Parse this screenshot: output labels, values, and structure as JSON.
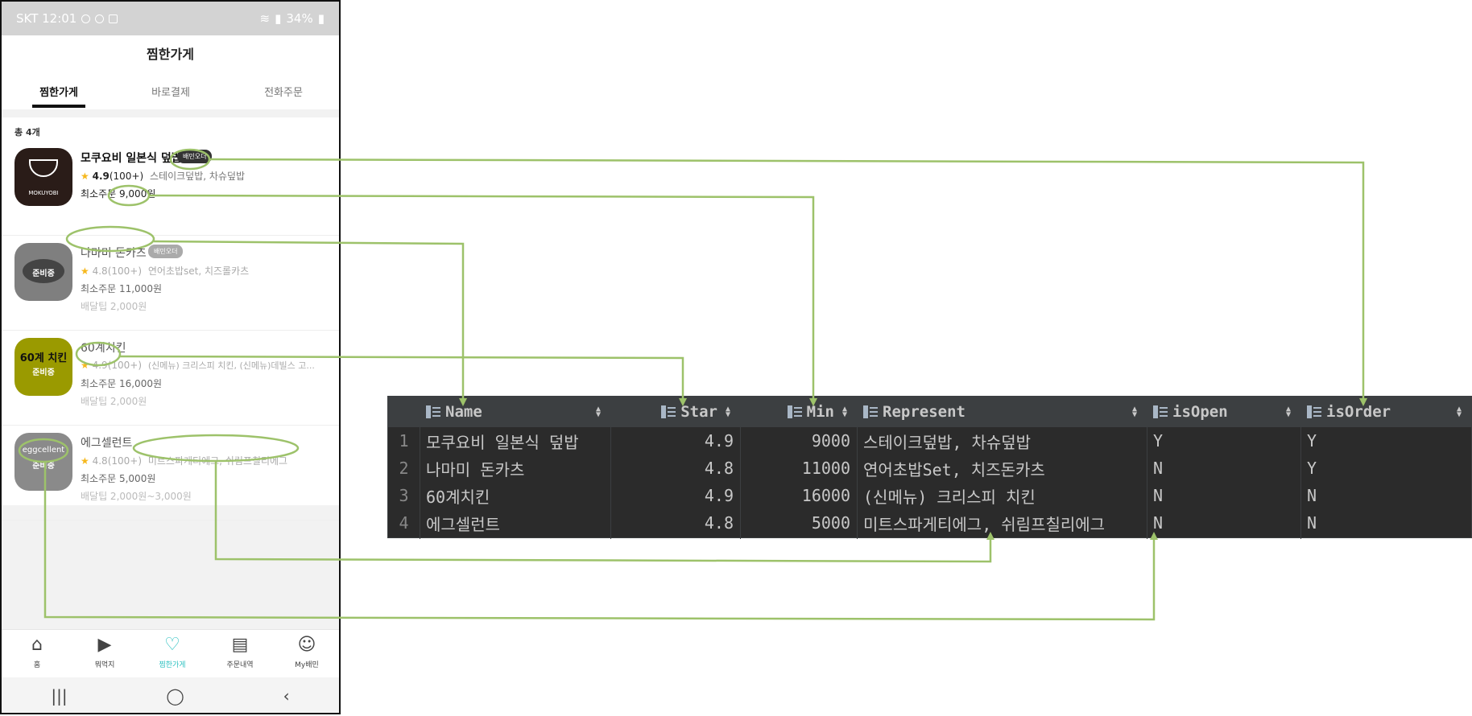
{
  "status": {
    "carrier_time": "SKT 12:01",
    "battery": "34%"
  },
  "header": {
    "title": "찜한가게"
  },
  "tabs": [
    {
      "label": "찜한가게"
    },
    {
      "label": "바로결제"
    },
    {
      "label": "전화주문"
    }
  ],
  "list": {
    "total": "총 4개"
  },
  "stores": [
    {
      "name": "모쿠요비 일본식 덮밥",
      "badge": "배민오더",
      "star": "★",
      "rating": "4.9",
      "reviews": "(100+)",
      "menu": "스테이크덮밥, 차슈덮밥",
      "min_order": "최소주문 9,000원",
      "logo_text": "MOKUYOBI",
      "logo_icon": "rice-bowl-icon"
    },
    {
      "name": "나마미 돈카츠",
      "badge": "배민오더",
      "star": "★",
      "rating": "4.8",
      "reviews": "(100+)",
      "menu": "연어초밥set, 치즈롤카츠",
      "min_order": "최소주문 11,000원",
      "tip": "배달팁 2,000원",
      "logo_text": "준비중"
    },
    {
      "name": "60계치킨",
      "star": "★",
      "rating": "4.9",
      "reviews": "(100+)",
      "menu": "(신메뉴) 크리스피 치킨, (신메뉴)데빌스 고...",
      "min_order": "최소주문 16,000원",
      "tip": "배달팁 2,000원",
      "logo_title": "60계 치킨",
      "logo_text": "준비중"
    },
    {
      "name": "에그셀런트",
      "star": "★",
      "rating": "4.8",
      "reviews": "(100+)",
      "menu": "미트스파게티에그, 쉬림프칠리에그",
      "min_order": "최소주문 5,000원",
      "tip": "배달팁 2,000원~3,000원",
      "logo_title": "eggcellent",
      "logo_text": "준비중"
    }
  ],
  "bottom_nav": [
    {
      "label": "홈",
      "icon": "home-icon"
    },
    {
      "label": "뭐먹지",
      "icon": "play-icon"
    },
    {
      "label": "찜한가게",
      "icon": "heart-icon"
    },
    {
      "label": "주문내역",
      "icon": "receipt-icon"
    },
    {
      "label": "My배민",
      "icon": "smile-icon"
    }
  ],
  "system_nav": {
    "recent": "|||",
    "home": "◯",
    "back": "‹"
  },
  "db_table": {
    "columns": [
      "Name",
      "Star",
      "Min",
      "Represent",
      "isOpen",
      "isOrder"
    ],
    "rows": [
      {
        "num": "1",
        "Name": "모쿠요비 일본식 덮밥",
        "Star": "4.9",
        "Min": "9000",
        "Represent": "스테이크덮밥, 차슈덮밥",
        "isOpen": "Y",
        "isOrder": "Y"
      },
      {
        "num": "2",
        "Name": "나마미 돈카츠",
        "Star": "4.8",
        "Min": "11000",
        "Represent": "연어초밥Set, 치즈돈카츠",
        "isOpen": "N",
        "isOrder": "Y"
      },
      {
        "num": "3",
        "Name": "60계치킨",
        "Star": "4.9",
        "Min": "16000",
        "Represent": "(신메뉴) 크리스피 치킨",
        "isOpen": "N",
        "isOrder": "N"
      },
      {
        "num": "4",
        "Name": "에그셀런트",
        "Star": "4.8",
        "Min": "5000",
        "Represent": "미트스파게티에그, 쉬림프칠리에그",
        "isOpen": "N",
        "isOrder": "N"
      }
    ]
  },
  "colors": {
    "annotation": "#9dc26a",
    "accent": "#2bc0c0",
    "db_bg": "#2b2b2b",
    "db_header": "#3c3f41"
  }
}
